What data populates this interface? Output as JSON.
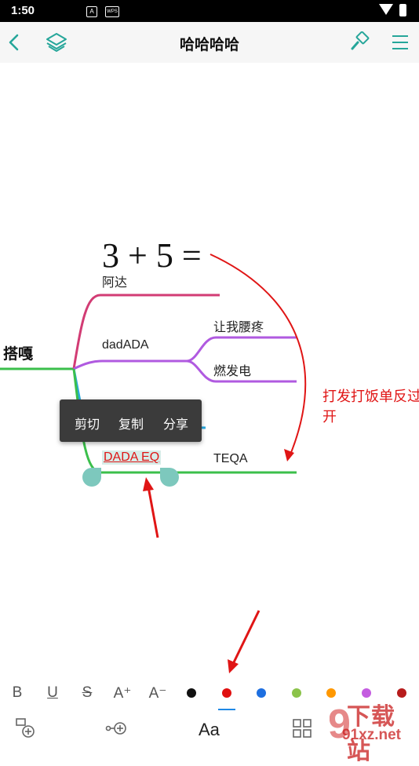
{
  "status_bar": {
    "time": "1:50",
    "notif1": "A",
    "notif2": "WPS"
  },
  "header": {
    "title": "哈哈哈哈"
  },
  "canvas": {
    "formula": "3 + 5 =",
    "root": "搭嘎",
    "nodes": {
      "a": "阿达",
      "b": "dadADA",
      "b1": "让我腰疼",
      "b2": "燃发电",
      "c": "DADA EQ",
      "d": "TEQA"
    },
    "annotation": "打发打饭单反过开"
  },
  "context_menu": {
    "cut": "剪切",
    "copy": "复制",
    "share": "分享"
  },
  "format_bar": {
    "bold": "B",
    "underline": "U",
    "strike": "S",
    "grow": "A⁺",
    "shrink": "A⁻",
    "colors": [
      "#111111",
      "#e01010",
      "#1e6fe0",
      "#8bc34a",
      "#ff9800",
      "#c45ce0",
      "#b71c1c"
    ],
    "selected_color": "#e01010"
  },
  "bottom_bar": {
    "font_label": "Aa"
  },
  "watermark": {
    "text": "下载站",
    "url": "91xz.net"
  }
}
